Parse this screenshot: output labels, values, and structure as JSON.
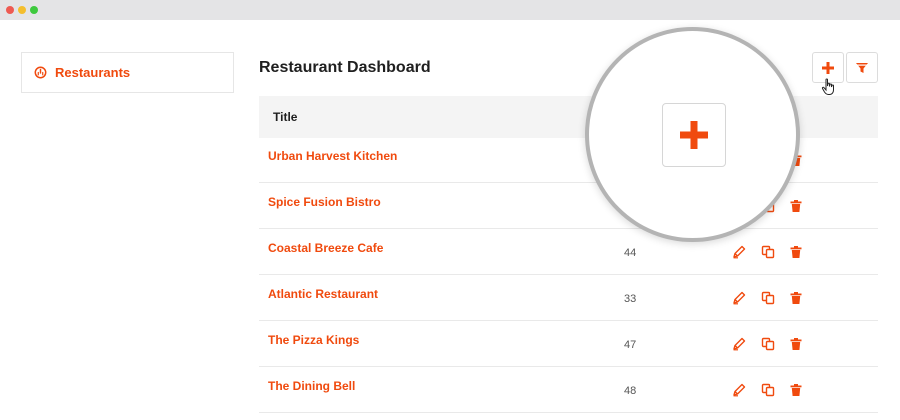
{
  "window": {
    "controls": [
      "close",
      "minimize",
      "maximize"
    ]
  },
  "sidebar": {
    "items": [
      {
        "label": "Restaurants",
        "icon": "gauge-icon"
      }
    ]
  },
  "page": {
    "title": "Restaurant Dashboard"
  },
  "toolbar": {
    "add_icon": "plus-icon",
    "filter_icon": "filter-icon"
  },
  "table": {
    "columns": [
      "Title"
    ],
    "rows": [
      {
        "title": "Urban Harvest Kitchen",
        "value": ""
      },
      {
        "title": "Spice Fusion Bistro",
        "value": ""
      },
      {
        "title": "Coastal Breeze Cafe",
        "value": "44"
      },
      {
        "title": "Atlantic Restaurant",
        "value": "33"
      },
      {
        "title": "The Pizza Kings",
        "value": "47"
      },
      {
        "title": "The Dining Bell",
        "value": "48"
      }
    ],
    "row_actions": [
      "edit-icon",
      "duplicate-icon",
      "trash-icon"
    ]
  },
  "colors": {
    "accent": "#f04a0e",
    "header_bg": "#f4f4f4",
    "titlebar_bg": "#e4e4e6"
  }
}
